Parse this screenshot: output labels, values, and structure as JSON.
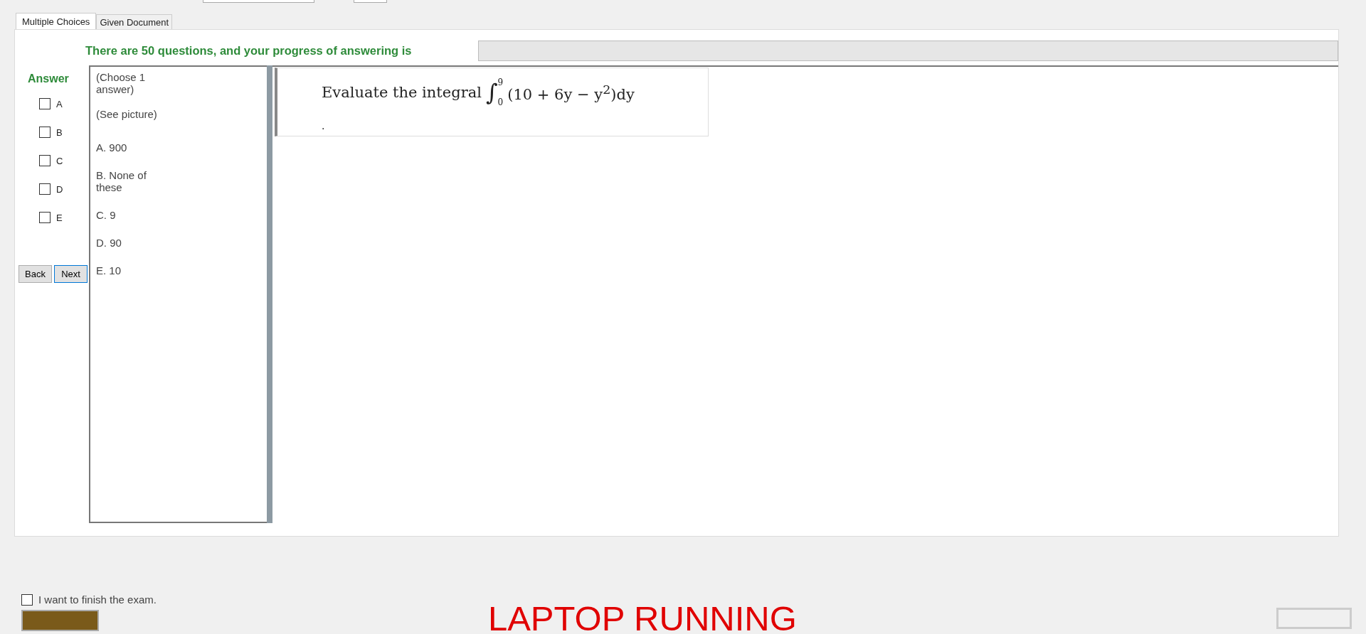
{
  "tabs": [
    {
      "label": "Multiple Choices",
      "selected": true
    },
    {
      "label": "Given Document",
      "selected": false
    }
  ],
  "progress": {
    "text": "There are 50 questions, and your progress of answering is",
    "level": 0
  },
  "answer": {
    "title": "Answer",
    "options": [
      {
        "label": "A",
        "checked": false
      },
      {
        "label": "B",
        "checked": false
      },
      {
        "label": "C",
        "checked": false
      },
      {
        "label": "D",
        "checked": false
      },
      {
        "label": "E",
        "checked": false
      }
    ]
  },
  "nav_buttons": [
    {
      "label": "Back",
      "focused": false
    },
    {
      "label": "Next",
      "focused": true
    }
  ],
  "question_text": {
    "intro": [
      "(Choose 1 answer)",
      "(See picture)"
    ],
    "choices": [
      "A.  900",
      "B.  None of these",
      "C.  9",
      "D.  90",
      "E.  10"
    ]
  },
  "question_image": {
    "lead": "Evaluate the integral",
    "integral": "∫",
    "upper": "9",
    "lower": "0",
    "expression": "(10 + 6y − y$^{2}$)dy",
    "end": "."
  },
  "finish": {
    "label": "I want to finish the exam.",
    "checked": false
  },
  "status": "LAPTOP RUNNING"
}
